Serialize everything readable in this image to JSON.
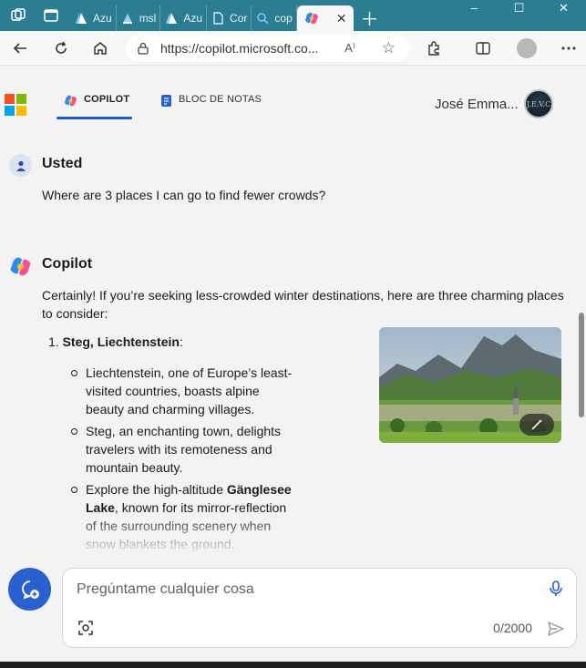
{
  "browser": {
    "tabs": [
      {
        "label": "Azu",
        "icon": "azure-icon"
      },
      {
        "label": "msl",
        "icon": "azure-ml-icon"
      },
      {
        "label": "Azu",
        "icon": "azure-icon"
      },
      {
        "label": "Cor",
        "icon": "document-icon"
      },
      {
        "label": "cop",
        "icon": "search-icon"
      },
      {
        "label": "",
        "icon": "copilot-icon",
        "active": true
      }
    ],
    "url": "https://copilot.microsoft.co...",
    "read_aloud": "A⁾"
  },
  "header": {
    "tabs": [
      {
        "label": "COPILOT",
        "active": true
      },
      {
        "label": "BLOC DE NOTAS",
        "active": false
      }
    ],
    "user_name": "José Emma...",
    "user_avatar_text": "J.E.V.C"
  },
  "conversation": {
    "user": {
      "author": "Usted",
      "text": "Where are 3 places I can go to find fewer crowds?"
    },
    "assistant": {
      "author": "Copilot",
      "intro_line1": "Certainly! If you’re seeking less-crowded winter destinations, here are three charming places",
      "intro_line2": "to consider:",
      "item_number": "1.",
      "item_title": "Steg, Liechtenstein",
      "item_suffix": ":",
      "bullet1": "Liechtenstein, one of Europe’s least-visited countries, boasts alpine beauty and charming villages.",
      "bullet2": "Steg, an enchanting town, delights travelers with its remoteness and mountain beauty.",
      "bullet3_prefix": "Explore the high-altitude ",
      "bullet3_bold": "Gänglesee Lake",
      "bullet3_suffix": ", known for its mirror-reflection of the surrounding scenery when snow blankets the ground."
    }
  },
  "composer": {
    "placeholder": "Pregúntame cualquier cosa",
    "char_count": "0/2000"
  },
  "colors": {
    "tabbar": "#2b7d92",
    "accent": "#175fc7",
    "new_topic": "#2a61d1"
  }
}
